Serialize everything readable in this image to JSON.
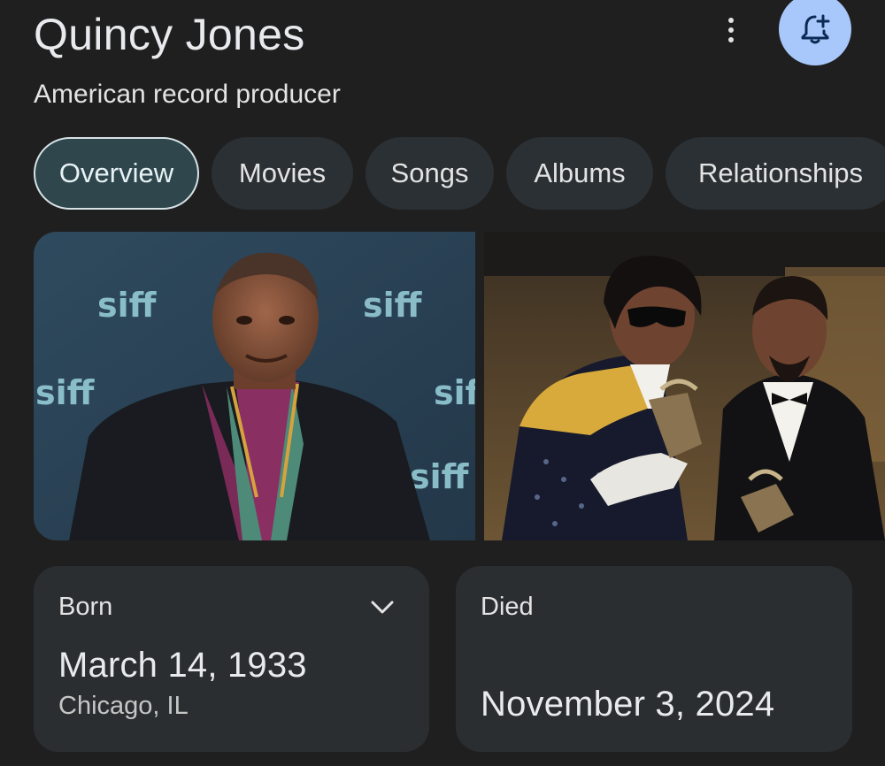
{
  "header": {
    "title": "Quincy Jones",
    "subtitle": "American record producer",
    "more_icon": "more-vert-icon",
    "follow_icon": "bell-plus-icon",
    "accent_color": "#a8c7fa"
  },
  "tabs": [
    {
      "label": "Overview",
      "active": true
    },
    {
      "label": "Movies",
      "active": false
    },
    {
      "label": "Songs",
      "active": false
    },
    {
      "label": "Albums",
      "active": false
    },
    {
      "label": "Relationships",
      "active": false
    }
  ],
  "gallery": {
    "photo_1_sign_text": "siff"
  },
  "facts": {
    "born": {
      "label": "Born",
      "date": "March 14, 1933",
      "place": "Chicago, IL",
      "expand_icon": "chevron-down-icon"
    },
    "died": {
      "label": "Died",
      "date": "November 3, 2024"
    }
  }
}
